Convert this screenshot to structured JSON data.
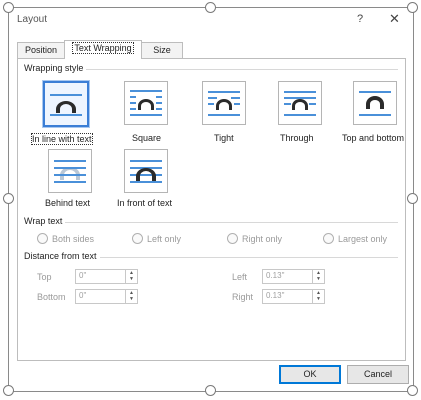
{
  "window": {
    "title": "Layout",
    "help_label": "?",
    "close_label": "✕"
  },
  "tabs": [
    {
      "label": "Position"
    },
    {
      "label": "Text Wrapping"
    },
    {
      "label": "Size"
    }
  ],
  "wrapping_style": {
    "heading": "Wrapping style",
    "selected": "In line with text",
    "options": [
      {
        "label": "In line with text",
        "icon": "wrap-inline-icon"
      },
      {
        "label": "Square",
        "icon": "wrap-square-icon"
      },
      {
        "label": "Tight",
        "icon": "wrap-tight-icon"
      },
      {
        "label": "Through",
        "icon": "wrap-through-icon"
      },
      {
        "label": "Top and bottom",
        "icon": "wrap-top-bottom-icon"
      },
      {
        "label": "Behind text",
        "icon": "wrap-behind-icon"
      },
      {
        "label": "In front of text",
        "icon": "wrap-front-icon"
      }
    ]
  },
  "wrap_text": {
    "heading": "Wrap text",
    "options": [
      "Both sides",
      "Left only",
      "Right only",
      "Largest only"
    ]
  },
  "distance": {
    "heading": "Distance from text",
    "top": {
      "label": "Top",
      "value": "0\""
    },
    "bottom": {
      "label": "Bottom",
      "value": "0\""
    },
    "left": {
      "label": "Left",
      "value": "0.13\""
    },
    "right": {
      "label": "Right",
      "value": "0.13\""
    }
  },
  "buttons": {
    "ok": "OK",
    "cancel": "Cancel"
  },
  "colors": {
    "accent": "#3b7ed6",
    "wrap_lines": "#4a90d9",
    "image_shape": "#2b2b2b"
  }
}
